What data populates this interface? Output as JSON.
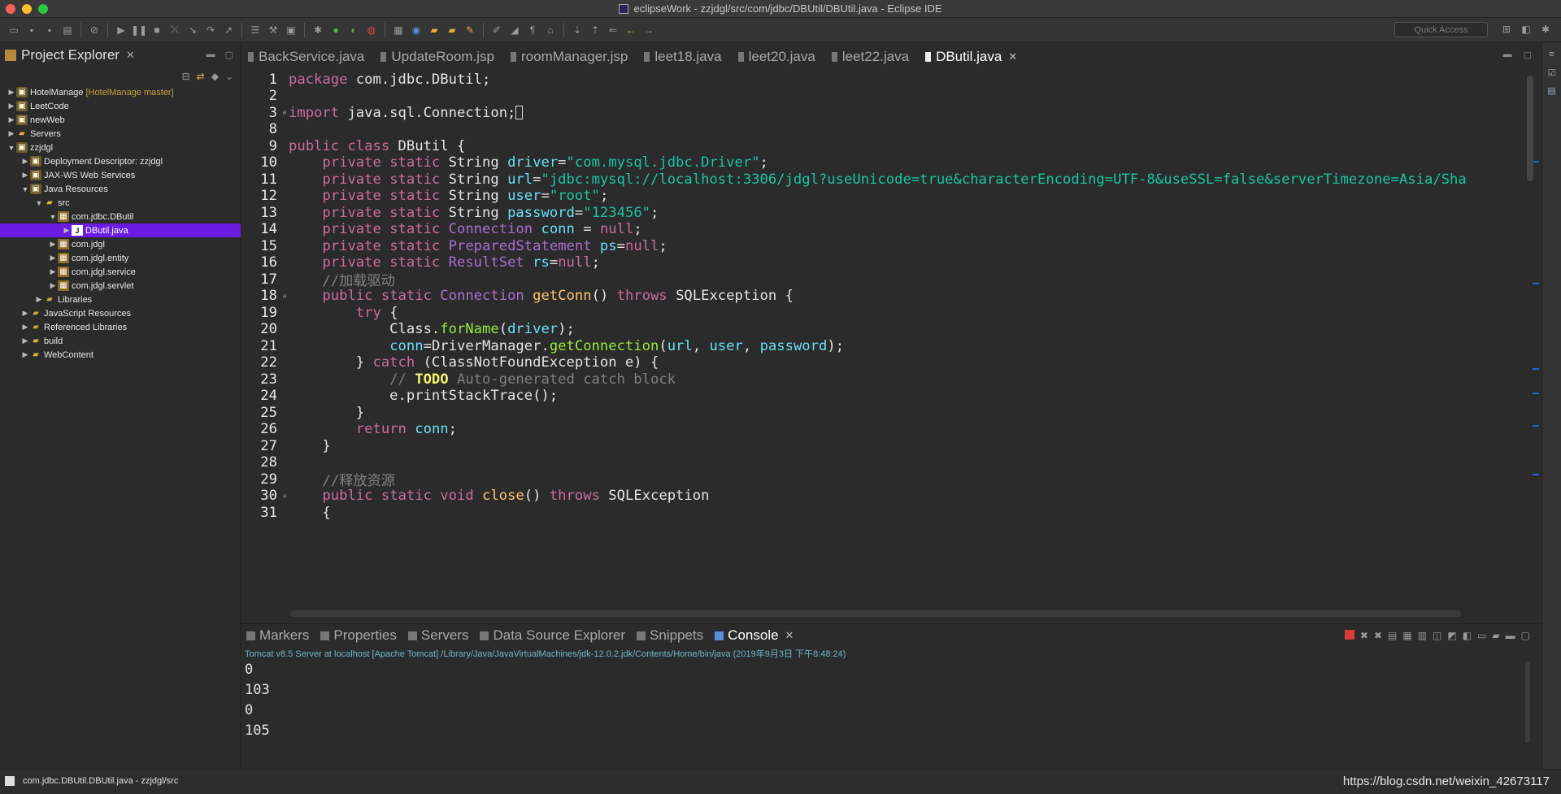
{
  "window": {
    "title": "eclipseWork - zzjdgl/src/com/jdbc/DBUtil/DBUtil.java - Eclipse IDE"
  },
  "toolbar": {
    "quick_access_placeholder": "Quick Access"
  },
  "explorer": {
    "title": "Project Explorer",
    "tree": [
      {
        "label": "HotelManage",
        "decoration": "[HotelManage master]",
        "depth": 0,
        "twisty": "▶",
        "icon": "project"
      },
      {
        "label": "LeetCode",
        "depth": 0,
        "twisty": "▶",
        "icon": "project"
      },
      {
        "label": "newWeb",
        "depth": 0,
        "twisty": "▶",
        "icon": "project"
      },
      {
        "label": "Servers",
        "depth": 0,
        "twisty": "▶",
        "icon": "folder"
      },
      {
        "label": "zzjdgl",
        "depth": 0,
        "twisty": "▼",
        "icon": "project"
      },
      {
        "label": "Deployment Descriptor: zzjdgl",
        "depth": 1,
        "twisty": "▶",
        "icon": "project"
      },
      {
        "label": "JAX-WS Web Services",
        "depth": 1,
        "twisty": "▶",
        "icon": "project"
      },
      {
        "label": "Java Resources",
        "depth": 1,
        "twisty": "▼",
        "icon": "project"
      },
      {
        "label": "src",
        "depth": 2,
        "twisty": "▼",
        "icon": "folder"
      },
      {
        "label": "com.jdbc.DButil",
        "depth": 3,
        "twisty": "▼",
        "icon": "package"
      },
      {
        "label": "DButil.java",
        "depth": 4,
        "twisty": "▶",
        "icon": "file",
        "selected": true
      },
      {
        "label": "com.jdgl",
        "depth": 3,
        "twisty": "▶",
        "icon": "package"
      },
      {
        "label": "com.jdgl.entity",
        "depth": 3,
        "twisty": "▶",
        "icon": "package"
      },
      {
        "label": "com.jdgl.service",
        "depth": 3,
        "twisty": "▶",
        "icon": "package"
      },
      {
        "label": "com.jdgl.servlet",
        "depth": 3,
        "twisty": "▶",
        "icon": "package"
      },
      {
        "label": "Libraries",
        "depth": 2,
        "twisty": "▶",
        "icon": "library"
      },
      {
        "label": "JavaScript Resources",
        "depth": 1,
        "twisty": "▶",
        "icon": "library"
      },
      {
        "label": "Referenced Libraries",
        "depth": 1,
        "twisty": "▶",
        "icon": "library"
      },
      {
        "label": "build",
        "depth": 1,
        "twisty": "▶",
        "icon": "folder"
      },
      {
        "label": "WebContent",
        "depth": 1,
        "twisty": "▶",
        "icon": "folder"
      }
    ]
  },
  "editor": {
    "tabs": [
      {
        "label": "BackService.java",
        "active": false
      },
      {
        "label": "UpdateRoom.jsp",
        "active": false
      },
      {
        "label": "roomManager.jsp",
        "active": false
      },
      {
        "label": "leet18.java",
        "active": false
      },
      {
        "label": "leet20.java",
        "active": false
      },
      {
        "label": "leet22.java",
        "active": false
      },
      {
        "label": "DButil.java",
        "active": true
      }
    ],
    "lines": [
      {
        "n": "1",
        "tokens": [
          [
            "kw",
            "package"
          ],
          [
            "c",
            " com.jdbc.DButil;"
          ]
        ]
      },
      {
        "n": "2",
        "tokens": []
      },
      {
        "n": "3",
        "fold": "⊕",
        "tokens": [
          [
            "kw",
            "import"
          ],
          [
            "c",
            " java.sql.Connection;"
          ],
          [
            "box",
            ""
          ]
        ]
      },
      {
        "n": "8",
        "tokens": []
      },
      {
        "n": "9",
        "tokens": [
          [
            "kw",
            "public class"
          ],
          [
            "c",
            " DButil {"
          ]
        ]
      },
      {
        "n": "10",
        "tokens": [
          [
            "c",
            "    "
          ],
          [
            "kw",
            "private static"
          ],
          [
            "c",
            " String "
          ],
          [
            "fld",
            "driver"
          ],
          [
            "c",
            "="
          ],
          [
            "str",
            "\"com.mysql.jdbc.Driver\""
          ],
          [
            "c",
            ";"
          ]
        ]
      },
      {
        "n": "11",
        "tokens": [
          [
            "c",
            "    "
          ],
          [
            "kw",
            "private static"
          ],
          [
            "c",
            " String "
          ],
          [
            "fld",
            "url"
          ],
          [
            "c",
            "="
          ],
          [
            "str",
            "\"jdbc:mysql://localhost:3306/jdgl?useUnicode=true&characterEncoding=UTF-8&useSSL=false&serverTimezone=Asia/Sha"
          ]
        ]
      },
      {
        "n": "12",
        "tokens": [
          [
            "c",
            "    "
          ],
          [
            "kw",
            "private static"
          ],
          [
            "c",
            " String "
          ],
          [
            "fld",
            "user"
          ],
          [
            "c",
            "="
          ],
          [
            "str",
            "\"root\""
          ],
          [
            "c",
            ";"
          ]
        ]
      },
      {
        "n": "13",
        "tokens": [
          [
            "c",
            "    "
          ],
          [
            "kw",
            "private static"
          ],
          [
            "c",
            " String "
          ],
          [
            "fld",
            "password"
          ],
          [
            "c",
            "="
          ],
          [
            "str",
            "\"123456\""
          ],
          [
            "c",
            ";"
          ]
        ]
      },
      {
        "n": "14",
        "tokens": [
          [
            "c",
            "    "
          ],
          [
            "kw",
            "private static"
          ],
          [
            "c",
            " "
          ],
          [
            "type",
            "Connection"
          ],
          [
            "c",
            " "
          ],
          [
            "fld",
            "conn"
          ],
          [
            "c",
            " = "
          ],
          [
            "kw",
            "null"
          ],
          [
            "c",
            ";"
          ]
        ]
      },
      {
        "n": "15",
        "tokens": [
          [
            "c",
            "    "
          ],
          [
            "kw",
            "private static"
          ],
          [
            "c",
            " "
          ],
          [
            "type",
            "PreparedStatement"
          ],
          [
            "c",
            " "
          ],
          [
            "fld",
            "ps"
          ],
          [
            "c",
            "="
          ],
          [
            "kw",
            "null"
          ],
          [
            "c",
            ";"
          ]
        ]
      },
      {
        "n": "16",
        "tokens": [
          [
            "c",
            "    "
          ],
          [
            "kw",
            "private static"
          ],
          [
            "c",
            " "
          ],
          [
            "type",
            "ResultSet"
          ],
          [
            "c",
            " "
          ],
          [
            "fld",
            "rs"
          ],
          [
            "c",
            "="
          ],
          [
            "kw",
            "null"
          ],
          [
            "c",
            ";"
          ]
        ]
      },
      {
        "n": "17",
        "tokens": [
          [
            "c",
            "    "
          ],
          [
            "cmt",
            "//加载驱动"
          ]
        ]
      },
      {
        "n": "18",
        "fold": "⊖",
        "tokens": [
          [
            "c",
            "    "
          ],
          [
            "kw",
            "public static"
          ],
          [
            "c",
            " "
          ],
          [
            "type",
            "Connection"
          ],
          [
            "c",
            " "
          ],
          [
            "meth",
            "getConn"
          ],
          [
            "c",
            "() "
          ],
          [
            "kw",
            "throws"
          ],
          [
            "c",
            " SQLException {"
          ]
        ]
      },
      {
        "n": "19",
        "tokens": [
          [
            "c",
            "        "
          ],
          [
            "kw",
            "try"
          ],
          [
            "c",
            " {"
          ]
        ]
      },
      {
        "n": "20",
        "tokens": [
          [
            "c",
            "            Class."
          ],
          [
            "static-m",
            "forName"
          ],
          [
            "c",
            "("
          ],
          [
            "fld",
            "driver"
          ],
          [
            "c",
            ");"
          ]
        ]
      },
      {
        "n": "21",
        "tokens": [
          [
            "c",
            "            "
          ],
          [
            "fld",
            "conn"
          ],
          [
            "c",
            "=DriverManager."
          ],
          [
            "static-m",
            "getConnection"
          ],
          [
            "c",
            "("
          ],
          [
            "fld",
            "url"
          ],
          [
            "c",
            ", "
          ],
          [
            "fld",
            "user"
          ],
          [
            "c",
            ", "
          ],
          [
            "fld",
            "password"
          ],
          [
            "c",
            ");"
          ]
        ]
      },
      {
        "n": "22",
        "tokens": [
          [
            "c",
            "        } "
          ],
          [
            "kw",
            "catch"
          ],
          [
            "c",
            " (ClassNotFoundException e) {"
          ]
        ]
      },
      {
        "n": "23",
        "tokens": [
          [
            "c",
            "            "
          ],
          [
            "cmt",
            "// "
          ],
          [
            "todo",
            "TODO"
          ],
          [
            "cmt",
            " Auto-generated catch block"
          ]
        ]
      },
      {
        "n": "24",
        "tokens": [
          [
            "c",
            "            e.printStackTrace();"
          ]
        ]
      },
      {
        "n": "25",
        "tokens": [
          [
            "c",
            "        }"
          ]
        ]
      },
      {
        "n": "26",
        "tokens": [
          [
            "c",
            "        "
          ],
          [
            "kw",
            "return"
          ],
          [
            "c",
            " "
          ],
          [
            "fld",
            "conn"
          ],
          [
            "c",
            ";"
          ]
        ]
      },
      {
        "n": "27",
        "tokens": [
          [
            "c",
            "    }"
          ]
        ]
      },
      {
        "n": "28",
        "tokens": []
      },
      {
        "n": "29",
        "tokens": [
          [
            "c",
            "    "
          ],
          [
            "cmt",
            "//释放资源"
          ]
        ]
      },
      {
        "n": "30",
        "fold": "⊖",
        "tokens": [
          [
            "c",
            "    "
          ],
          [
            "kw",
            "public static void"
          ],
          [
            "c",
            " "
          ],
          [
            "meth",
            "close"
          ],
          [
            "c",
            "() "
          ],
          [
            "kw",
            "throws"
          ],
          [
            "c",
            " SQLException"
          ]
        ]
      },
      {
        "n": "31",
        "tokens": [
          [
            "c",
            "    {"
          ]
        ]
      }
    ]
  },
  "bottom": {
    "tabs": [
      {
        "label": "Markers",
        "active": false
      },
      {
        "label": "Properties",
        "active": false
      },
      {
        "label": "Servers",
        "active": false
      },
      {
        "label": "Data Source Explorer",
        "active": false
      },
      {
        "label": "Snippets",
        "active": false
      },
      {
        "label": "Console",
        "active": true
      }
    ],
    "console_header": "Tomcat v8.5 Server at localhost [Apache Tomcat] /Library/Java/JavaVirtualMachines/jdk-12.0.2.jdk/Contents/Home/bin/java (2019年9月3日 下午8:48:24)",
    "output": [
      "0",
      "103",
      "0",
      "105"
    ]
  },
  "status": {
    "left": "com.jdbc.DBUtil.DBUtil.java - zzjdgl/src",
    "right": "https://blog.csdn.net/weixin_42673117"
  },
  "colors": {
    "keyword": "#cc6c9c",
    "string": "#17c6a3",
    "comment": "#808080",
    "todo": "#f6f36b",
    "selection": "#6a1ce3"
  }
}
